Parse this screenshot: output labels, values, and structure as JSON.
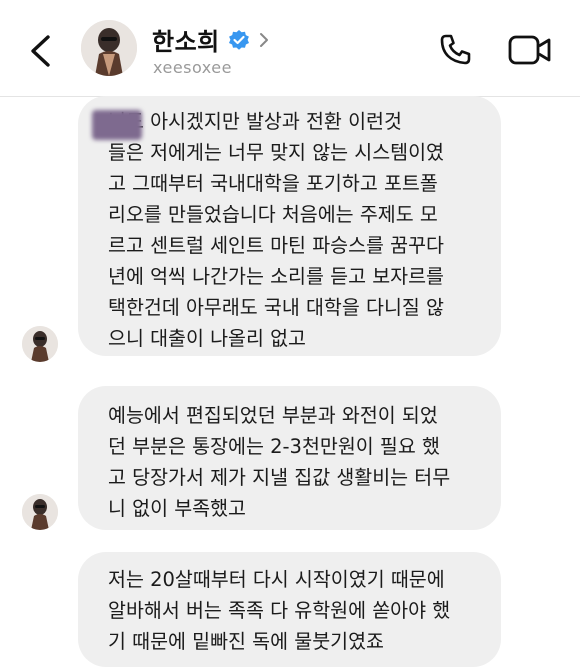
{
  "header": {
    "display_name": "한소희",
    "username": "xeesoxee"
  },
  "icons": {
    "back": "chevron-left-icon",
    "verified": "verified-badge-icon",
    "profile_chevron": "chevron-right-icon",
    "call": "phone-icon",
    "video": "video-camera-icon"
  },
  "colors": {
    "verified_blue": "#3897f0",
    "bubble_bg": "#efefef"
  },
  "messages": [
    {
      "text": "님도 아시겠지만 발상과 전환 이런것\n들은 저에게는 너무 맞지 않는 시스템이였\n고 그때부터 국내대학을 포기하고 포트폴\n리오를 만들었습니다 처음에는 주제도 모\n르고 센트럴 세인트 마틴 파승스를 꿈꾸다\n년에 억씩 나간가는 소리를 듣고 보자르를\n택한건데 아무래도 국내 대학을 다니질 않\n으니 대출이 나올리 없고"
    },
    {
      "text": "예능에서 편집되었던 부분과 와전이 되었\n던 부분은 통장에는 2-3천만원이 필요 했\n고 당장가서 제가 지낼 집값 생활비는 터무\n니 없이 부족했고"
    },
    {
      "text": "저는 20살때부터 다시 시작이였기 때문에\n알바해서 버는 족족 다 유학원에 쏟아야 했\n기 때문에 밑빠진 독에 물붓기였죠"
    }
  ]
}
